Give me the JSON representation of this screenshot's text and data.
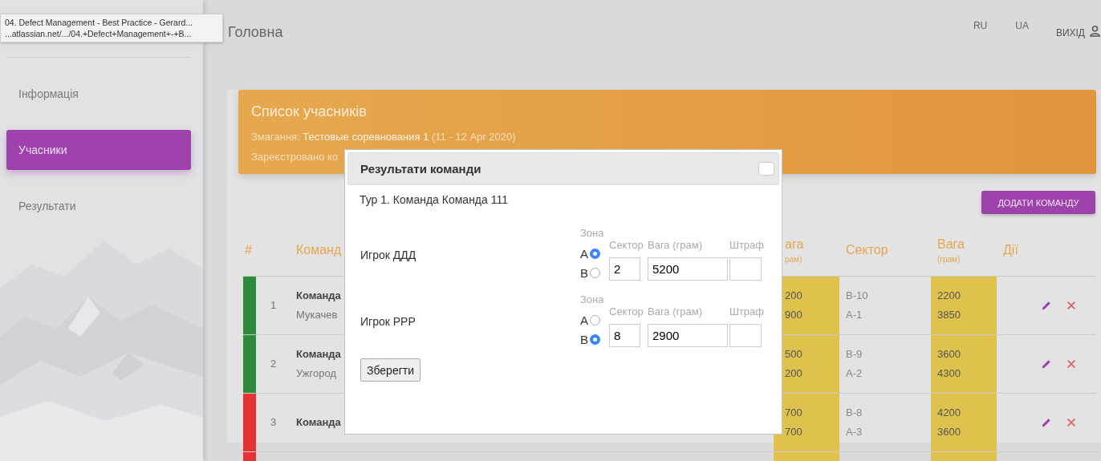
{
  "tooltip": {
    "title": "04. Defect Management - Best Practice - Gerard...",
    "url": "...atlassian.net/.../04.+Defect+Management+-+B..."
  },
  "sidebar": {
    "items": [
      {
        "label": "Інформація",
        "selected": false
      },
      {
        "label": "Учасники",
        "selected": true
      },
      {
        "label": "Результати",
        "selected": false
      }
    ]
  },
  "header": {
    "title": "Головна",
    "languages": [
      "RU",
      "UA"
    ],
    "logout": "ВИХІД"
  },
  "banner": {
    "title": "Список учасників",
    "competition": "Змагання: **Тестовые соревнования 1** (11 - 12 Apr 2020)",
    "registered": "Зареєстровано ко"
  },
  "add_button": "ДОДАТИ КОМАНДУ",
  "table": {
    "columns": [
      {
        "label": "#"
      },
      {
        "label": "Команд"
      },
      {
        "label": "ага",
        "sublabel": "рам)"
      },
      {
        "label": "Сектор"
      },
      {
        "label": "Вага",
        "sublabel": "(грам)"
      },
      {
        "label": "Дії"
      }
    ],
    "rows": [
      {
        "number": "1",
        "color": "#2e8b3e",
        "name": "Команда",
        "city": "Мукачев",
        "weights": [
          "200",
          "900"
        ],
        "sectors": [
          "B-10",
          "A-1"
        ],
        "weights_2": [
          "2200",
          "3850"
        ]
      },
      {
        "number": "2",
        "color": "#2e8b3e",
        "name": "Команда",
        "city": "Ужгород",
        "weights": [
          "500",
          "200"
        ],
        "sectors": [
          "B-9",
          "A-2"
        ],
        "weights_2": [
          "3600",
          "4300"
        ]
      },
      {
        "number": "3",
        "color": "#e53333",
        "name": "Команда",
        "weights": [
          "700",
          "700"
        ],
        "sectors": [
          "B-8",
          "A-3"
        ],
        "weights_2": [
          "4200",
          "3600"
        ]
      },
      {
        "color": "#e53333"
      }
    ]
  },
  "modal": {
    "title": "Результати команди",
    "subtitle": "Тур 1. Команда Команда 111",
    "players": [
      {
        "name": "Игрок ДДД",
        "zone_label": "Зона",
        "zones": [
          {
            "label": "A",
            "selected": true
          },
          {
            "label": "B",
            "selected": false
          }
        ],
        "sector_label": "Сектор",
        "weight_label": "Вага (грам)",
        "penalty_label": "Штраф",
        "sector": "2",
        "weight": "5200"
      },
      {
        "name": "Игрок РРР",
        "zone_label": "Зона",
        "zones": [
          {
            "label": "A",
            "selected": false
          },
          {
            "label": "B",
            "selected": true
          }
        ],
        "sector_label": "Сектор",
        "weight_label": "Вага (грам)",
        "penalty_label": "Штраф",
        "sector": "8",
        "weight": "2900"
      }
    ],
    "save": "Зберегти"
  }
}
